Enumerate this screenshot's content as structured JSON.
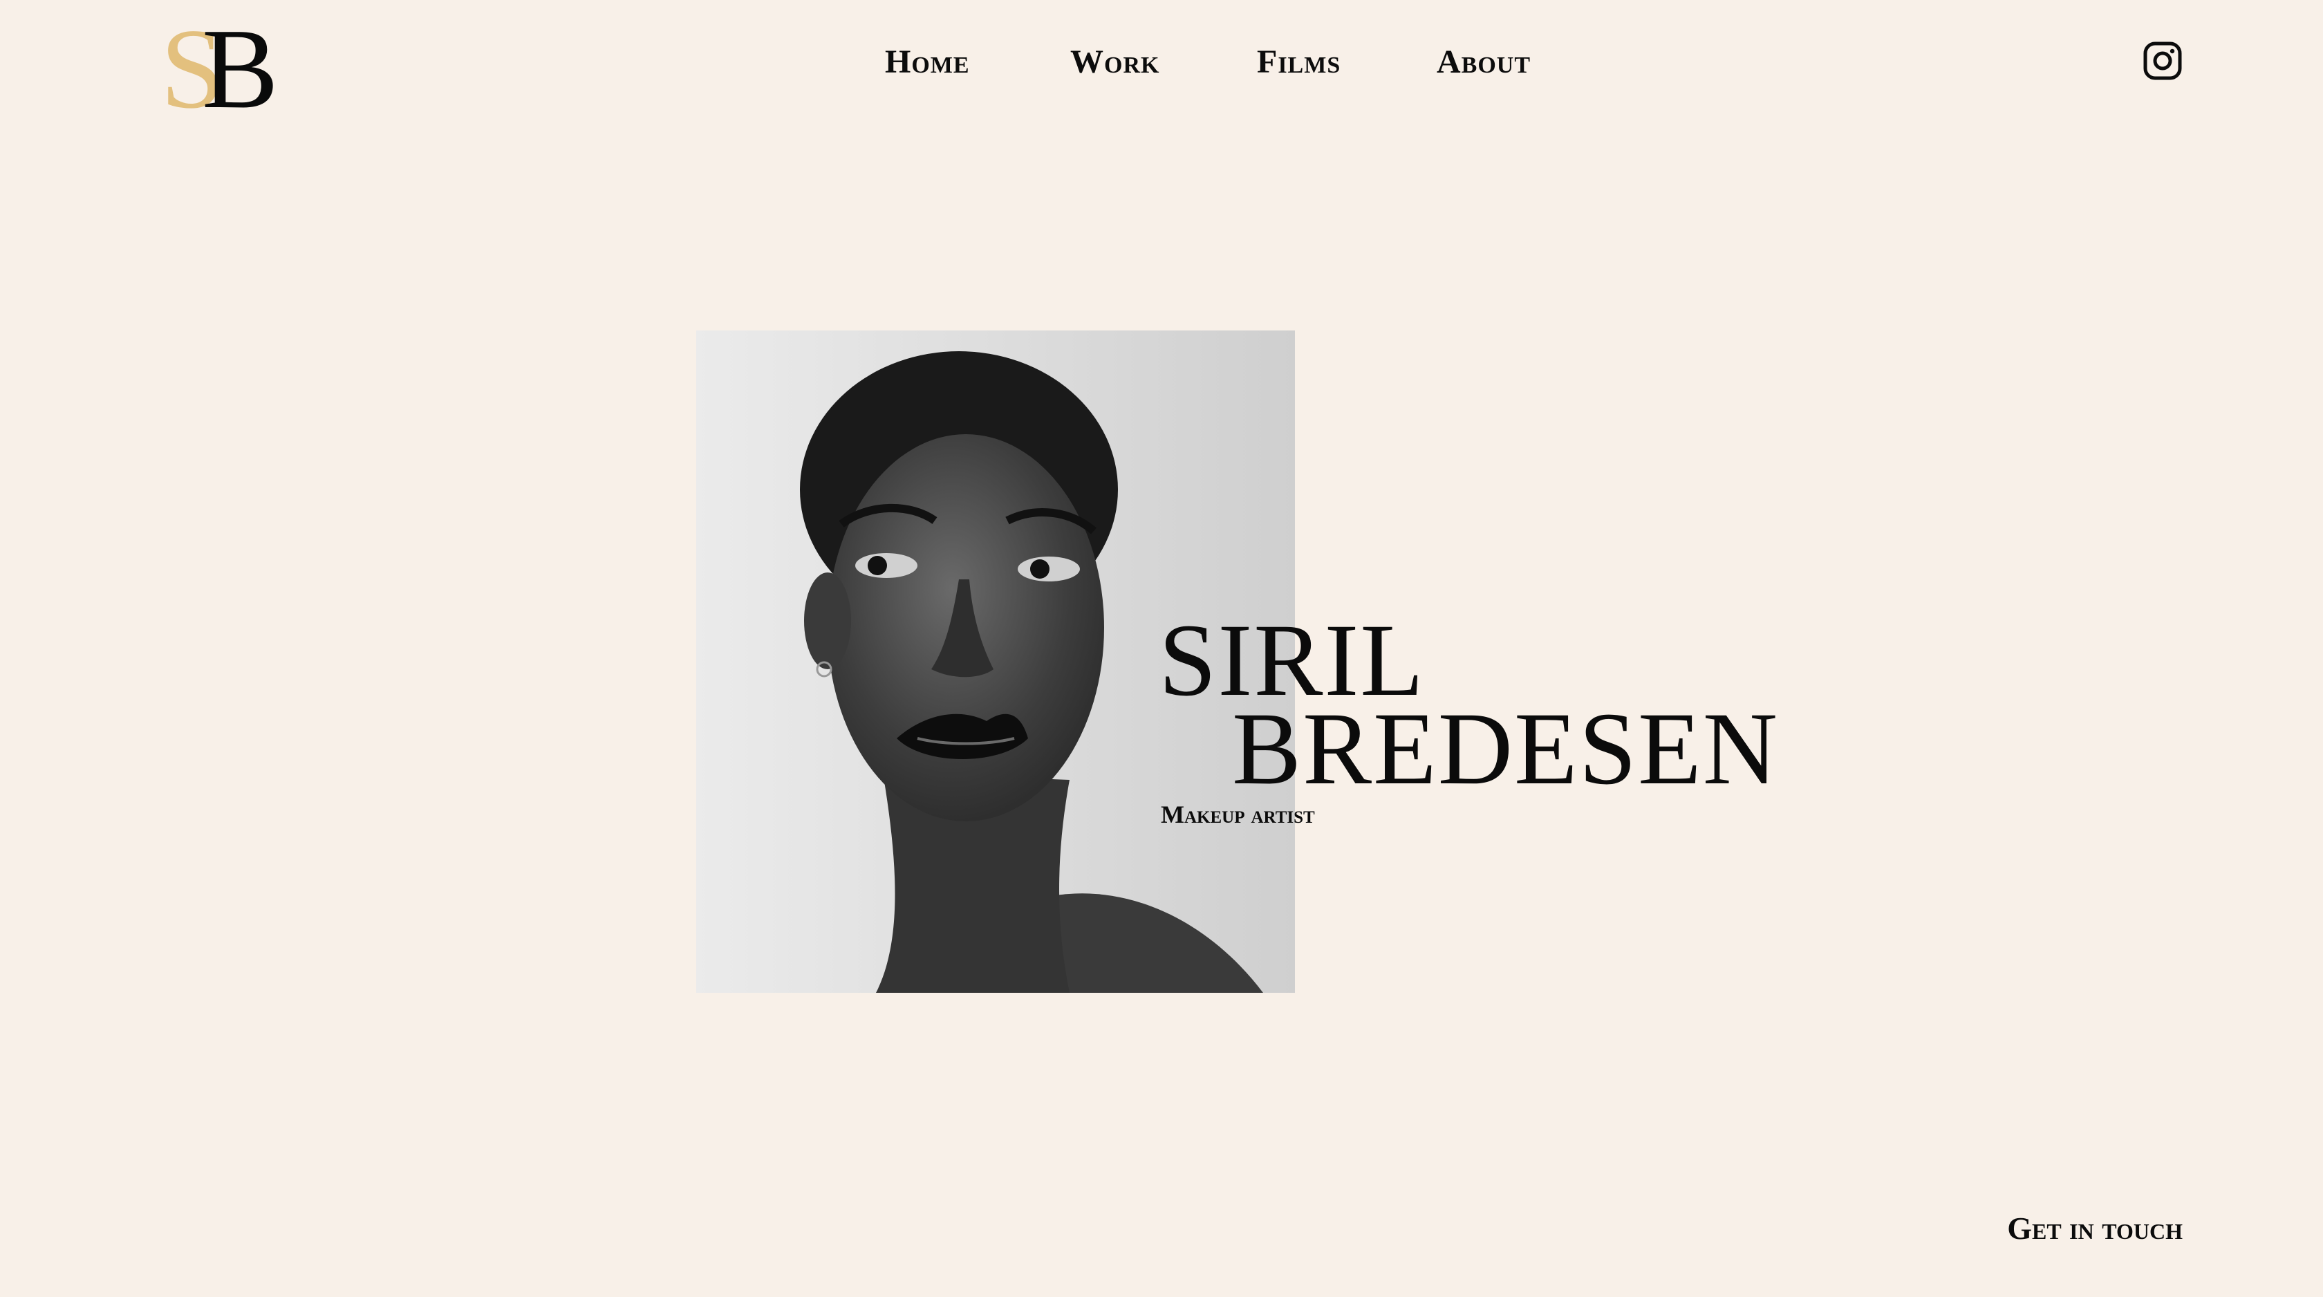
{
  "brand": {
    "logo_letters": "SB",
    "logo_color_s": "#e3c07e",
    "logo_color_b": "#0a0a0a"
  },
  "nav": {
    "items": [
      {
        "label": "Home"
      },
      {
        "label": "Work"
      },
      {
        "label": "Films"
      },
      {
        "label": "About"
      }
    ]
  },
  "social": {
    "icon": "instagram-icon"
  },
  "hero": {
    "name_line1": "SIRIL",
    "name_line2": "BREDESEN",
    "subtitle": "Makeup artist",
    "image_description": "black and white portrait"
  },
  "cta": {
    "label": "Get in touch"
  },
  "colors": {
    "background": "#f8f0e8",
    "text": "#0c0c0c"
  }
}
